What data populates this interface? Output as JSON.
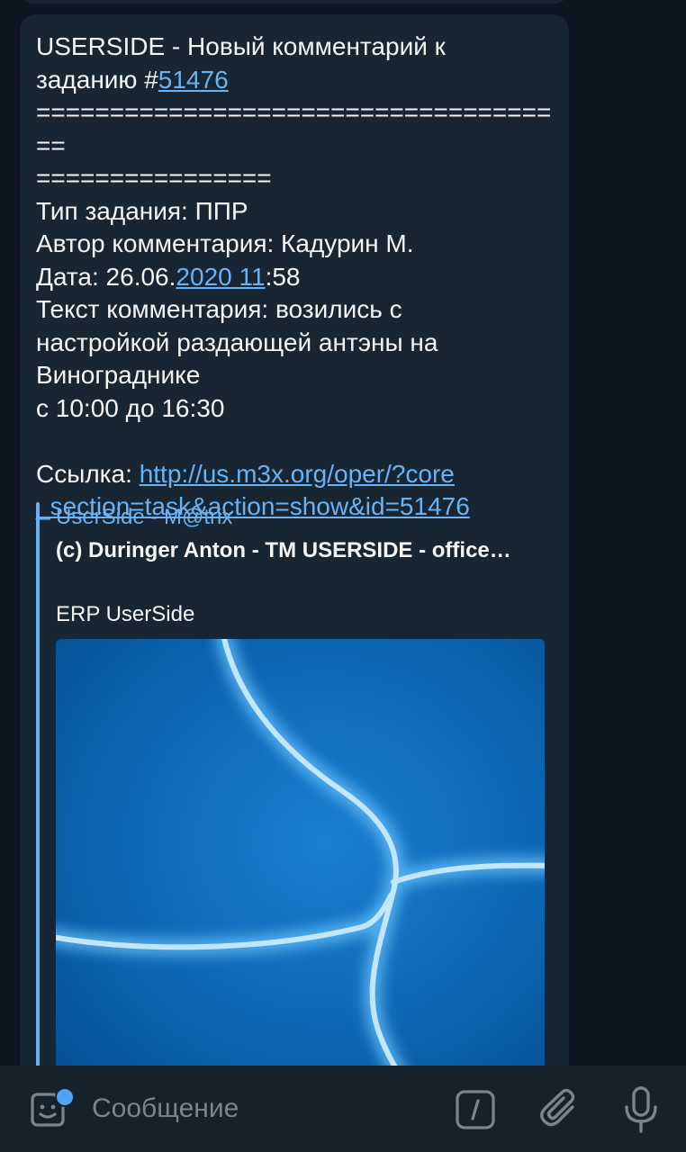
{
  "message": {
    "line1": "USERSIDE - Новый комментарий к",
    "line2_prefix": "заданию #",
    "task_link": "51476",
    "separator1": "=====================================",
    "separator2": "================",
    "task_type": "Тип задания: ППР",
    "author": "Автор комментария: Кадурин М.",
    "date_prefix": "Дата: 26.06.",
    "date_link": "2020 11",
    "date_suffix": ":58",
    "text_line1": "Текст комментария: возились с",
    "text_line2": "настройкой раздающей антэны на",
    "text_line3": "Винограднике",
    "text_line4": "с 10:00 до 16:30",
    "link_label": "Ссылка: ",
    "url_part1": "http://us.m3x.org/oper/?core",
    "url_part2": "_section=task&action=show&id=51476"
  },
  "preview": {
    "site_name": "UserSide - M@trix",
    "title": "(c) Duringer Anton - TM USERSIDE - office…",
    "description": "ERP UserSide"
  },
  "input": {
    "placeholder": "Сообщение"
  },
  "icons": {
    "emoji": "sticker-emoji-icon",
    "commands": "bot-commands-icon",
    "attach": "paperclip-icon",
    "voice": "microphone-icon"
  },
  "colors": {
    "chat_background": "#0e1621",
    "bubble": "#182533",
    "link": "#6ab3f3",
    "text": "#f5f5f5",
    "input_bar": "#17212b",
    "placeholder": "#7a8590",
    "notification_dot": "#4ea4f6"
  }
}
